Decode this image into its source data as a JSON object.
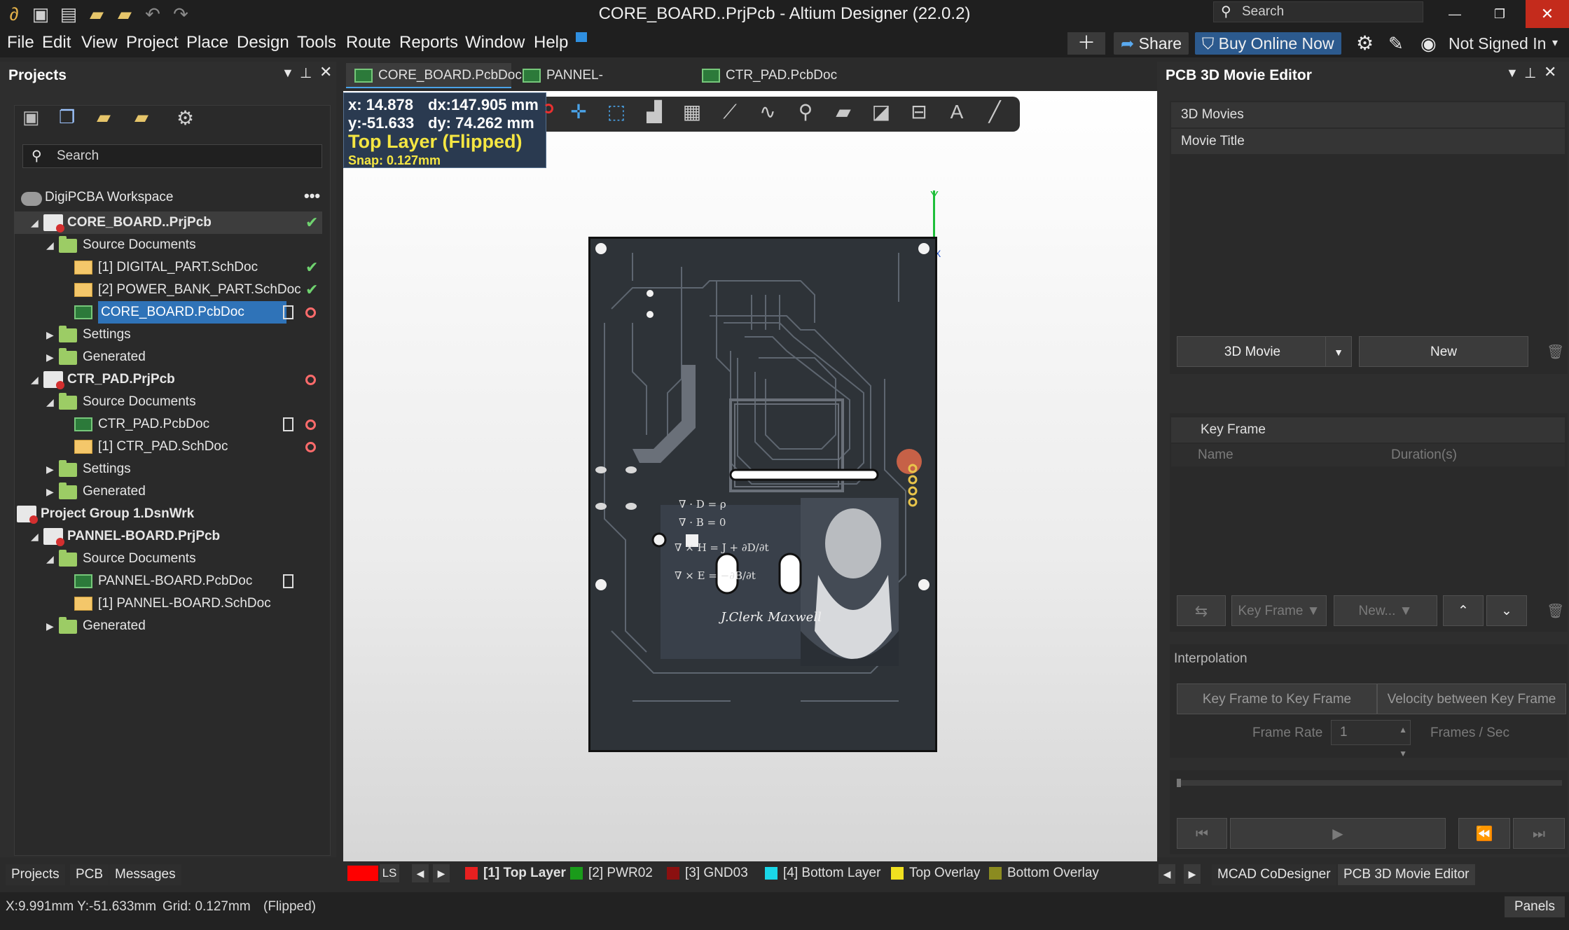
{
  "window": {
    "title": "CORE_BOARD..PrjPcb - Altium Designer (22.0.2)",
    "search_placeholder": "Search",
    "minimize": "—",
    "maximize": "❐",
    "close": "✕"
  },
  "menu": [
    "File",
    "Edit",
    "View",
    "Project",
    "Place",
    "Design",
    "Tools",
    "Route",
    "Reports",
    "Window",
    "Help"
  ],
  "toolbar": {
    "share": "Share",
    "buy": "Buy Online Now",
    "account": "Not Signed In"
  },
  "projects_panel": {
    "title": "Projects",
    "search_placeholder": "Search",
    "workspace": "DigiPCBA Workspace",
    "rows": [
      {
        "label": "CORE_BOARD..PrjPcb",
        "type": "prj",
        "indent": 1,
        "bold": true,
        "status": "check",
        "selected": true
      },
      {
        "label": "Source Documents",
        "type": "folder",
        "indent": 2
      },
      {
        "label": "[1] DIGITAL_PART.SchDoc",
        "type": "sch",
        "indent": 3,
        "status": "check"
      },
      {
        "label": "[2] POWER_BANK_PART.SchDoc",
        "type": "sch",
        "indent": 3,
        "status": "check"
      },
      {
        "label": "CORE_BOARD.PcbDoc",
        "type": "pcb",
        "indent": 3,
        "status": "doc-red",
        "active": true
      },
      {
        "label": "Settings",
        "type": "folder",
        "indent": 2
      },
      {
        "label": "Generated",
        "type": "folder",
        "indent": 2
      },
      {
        "label": "CTR_PAD.PrjPcb",
        "type": "prj",
        "indent": 1,
        "bold": true,
        "status": "red"
      },
      {
        "label": "Source Documents",
        "type": "folder",
        "indent": 2
      },
      {
        "label": "CTR_PAD.PcbDoc",
        "type": "pcb",
        "indent": 3,
        "status": "doc-red"
      },
      {
        "label": "[1] CTR_PAD.SchDoc",
        "type": "sch",
        "indent": 3,
        "status": "red"
      },
      {
        "label": "Settings",
        "type": "folder",
        "indent": 2
      },
      {
        "label": "Generated",
        "type": "folder",
        "indent": 2
      },
      {
        "label": "Project Group 1.DsnWrk",
        "type": "grp",
        "indent": 0,
        "bold": true
      },
      {
        "label": "PANNEL-BOARD.PrjPcb",
        "type": "prj",
        "indent": 1,
        "bold": true
      },
      {
        "label": "Source Documents",
        "type": "folder",
        "indent": 2
      },
      {
        "label": "PANNEL-BOARD.PcbDoc",
        "type": "pcb",
        "indent": 3,
        "status": "doc"
      },
      {
        "label": "[1] PANNEL-BOARD.SchDoc",
        "type": "sch",
        "indent": 3
      },
      {
        "label": "Generated",
        "type": "folder",
        "indent": 2
      }
    ]
  },
  "doc_tabs": [
    "CORE_BOARD.PcbDoc",
    "PANNEL-BOARD.PcbDoc",
    "CTR_PAD.PcbDoc"
  ],
  "hud": {
    "x": "x: 14.878",
    "dx": "dx:147.905 mm",
    "y": "y:-51.633",
    "dy": "dy: 74.262  mm",
    "layer": "Top Layer (Flipped)",
    "snap": "Snap: 0.127mm"
  },
  "axis": {
    "y": "Y",
    "x": "X"
  },
  "layers": {
    "ls": "LS",
    "items": [
      {
        "label": "[1] Top Layer",
        "color": "#e82020",
        "bold": true
      },
      {
        "label": "[2] PWR02",
        "color": "#1a9b1a"
      },
      {
        "label": "[3] GND03",
        "color": "#8b1010"
      },
      {
        "label": "[4] Bottom Layer",
        "color": "#1ad7e8"
      },
      {
        "label": "Top Overlay",
        "color": "#f0e020"
      },
      {
        "label": "Bottom Overlay",
        "color": "#8b8b20"
      }
    ]
  },
  "bottom_tabs_left": [
    "Projects",
    "PCB",
    "Messages"
  ],
  "bottom_tabs_right": [
    "MCAD CoDesigner",
    "PCB 3D Movie Editor"
  ],
  "status": {
    "coords": "X:9.991mm Y:-51.633mm",
    "grid": "Grid: 0.127mm",
    "flipped": "(Flipped)",
    "panels": "Panels"
  },
  "movie_editor": {
    "title": "PCB 3D Movie Editor",
    "movies_header": "3D Movies",
    "movie_title": "Movie Title",
    "movie_dropdown": "3D Movie",
    "new_button": "New",
    "keyframe_header": "Key Frame",
    "col_name": "Name",
    "col_duration": "Duration(s)",
    "keyframe_dropdown": "Key Frame",
    "new_dropdown": "New...",
    "interpolation": "Interpolation",
    "kf_to_kf": "Key Frame to Key Frame",
    "velocity": "Velocity between Key Frame",
    "frame_rate_label": "Frame Rate",
    "frame_rate_value": "1",
    "frames_unit": "Frames / Sec"
  },
  "pcb_art": {
    "equations": [
      "∇ · D = ρ",
      "∇ · B = 0",
      "∇ × H = J + ∂D/∂t",
      "∇ × E = −∂B/∂t"
    ],
    "signature": "J.Clerk Maxwell"
  }
}
